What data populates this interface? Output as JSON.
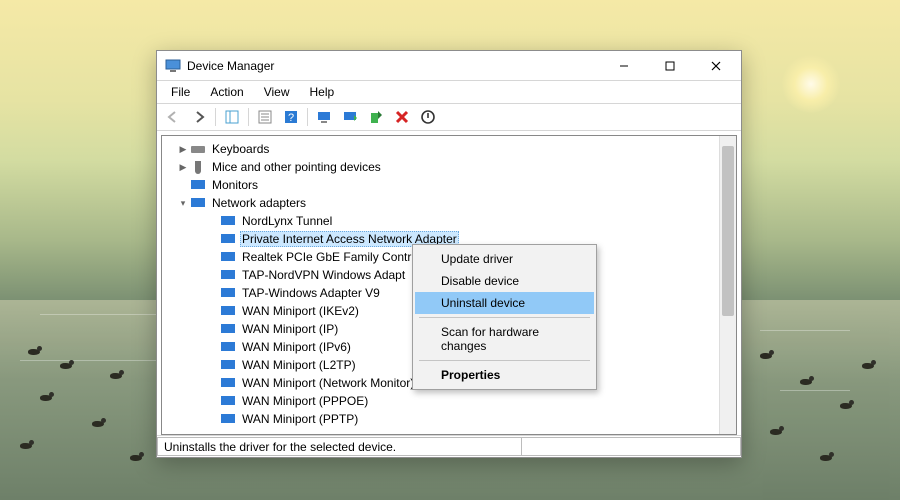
{
  "window": {
    "title": "Device Manager"
  },
  "menu": {
    "file": "File",
    "action": "Action",
    "view": "View",
    "help": "Help"
  },
  "tree": {
    "keyboards": "Keyboards",
    "mice": "Mice and other pointing devices",
    "monitors": "Monitors",
    "network": "Network adapters",
    "adapters": [
      "NordLynx Tunnel",
      "Private Internet Access Network Adapter",
      "Realtek PCIe GbE Family Contr",
      "TAP-NordVPN Windows Adapt",
      "TAP-Windows Adapter V9",
      "WAN Miniport (IKEv2)",
      "WAN Miniport (IP)",
      "WAN Miniport (IPv6)",
      "WAN Miniport (L2TP)",
      "WAN Miniport (Network Monitor)",
      "WAN Miniport (PPPOE)",
      "WAN Miniport (PPTP)"
    ],
    "selected_index": 1
  },
  "context_menu": {
    "update": "Update driver",
    "disable": "Disable device",
    "uninstall": "Uninstall device",
    "scan": "Scan for hardware changes",
    "properties": "Properties",
    "highlighted": "uninstall"
  },
  "status": {
    "text": "Uninstalls the driver for the selected device."
  }
}
